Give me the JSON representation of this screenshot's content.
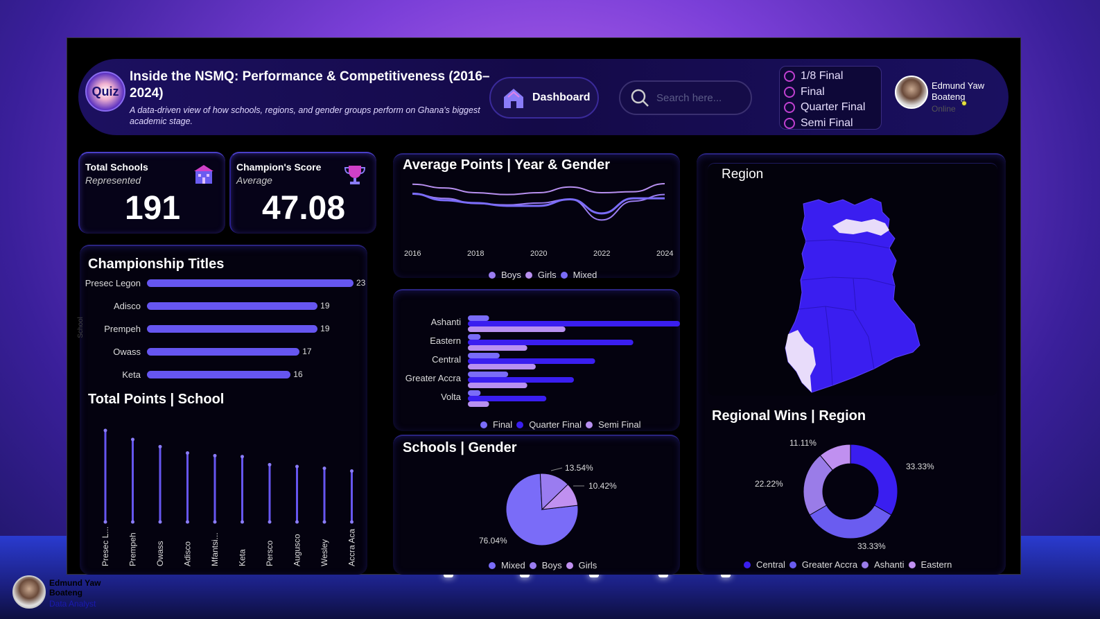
{
  "header": {
    "title": "Inside the NSMQ: Performance & Competitiveness (2016–2024)",
    "subtitle": "A data-driven view of how schools, regions, and gender groups perform on Ghana's biggest academic stage.",
    "logo_text": "Quiz",
    "dashboard_label": "Dashboard",
    "search_placeholder": "Search here...",
    "stage_filters": [
      "1/8 Final",
      "Final",
      "Quarter Final",
      "Semi Final"
    ],
    "user_name_line1": "Edmund Yaw",
    "user_name_line2": "Boateng",
    "user_status": "Online"
  },
  "kpis": {
    "schools": {
      "title": "Total Schools",
      "subtitle": "Represented",
      "value": "191"
    },
    "champion": {
      "title": "Champion's Score",
      "subtitle": "Average",
      "value": "47.08"
    }
  },
  "colors": {
    "accent": "#6656f0",
    "boys": "#9a7cf0",
    "girls": "#b890f0",
    "mixed": "#7a6cf8",
    "central": "#3a1ef0",
    "greater_accra": "#6a5cf0",
    "ashanti": "#9a7ce8",
    "eastern": "#c090f0"
  },
  "championship": {
    "title": "Championship Titles",
    "axis_label": "School",
    "schools": [
      "Presec Legon",
      "Adisco",
      "Prempeh",
      "Owass",
      "Keta"
    ],
    "values": [
      23,
      19,
      19,
      17,
      16
    ]
  },
  "total_points": {
    "title": "Total Points | School",
    "schools": [
      "Presec L...",
      "Prempeh",
      "Owass",
      "Adisco",
      "Mfantsi...",
      "Keta",
      "Persco",
      "Augusco",
      "Wesley",
      "Accra Aca"
    ],
    "relative": [
      1.0,
      0.9,
      0.82,
      0.75,
      0.72,
      0.71,
      0.62,
      0.6,
      0.58,
      0.55
    ]
  },
  "chart_data": [
    {
      "type": "line",
      "title": "Average Points | Year & Gender",
      "x": [
        2016,
        2017,
        2018,
        2019,
        2020,
        2021,
        2022,
        2023,
        2024
      ],
      "x_ticks": [
        "2016",
        "2018",
        "2020",
        "2022",
        "2024"
      ],
      "series": [
        {
          "name": "Boys",
          "values": [
            0.75,
            0.66,
            0.55,
            0.52,
            0.56,
            0.64,
            0.2,
            0.6,
            0.74
          ]
        },
        {
          "name": "Girls",
          "values": [
            0.96,
            0.88,
            0.78,
            0.74,
            0.78,
            0.9,
            0.78,
            0.8,
            0.97
          ]
        },
        {
          "name": "Mixed",
          "values": [
            0.76,
            0.62,
            0.56,
            0.5,
            0.5,
            0.64,
            0.34,
            0.66,
            0.66
          ]
        }
      ]
    },
    {
      "type": "bar",
      "orientation": "horizontal",
      "categories": [
        "Ashanti",
        "Eastern",
        "Central",
        "Greater Accra",
        "Volta"
      ],
      "series": [
        {
          "name": "Final",
          "values": [
            0.1,
            0.06,
            0.15,
            0.19,
            0.06
          ]
        },
        {
          "name": "Quarter Final",
          "values": [
            1.0,
            0.78,
            0.6,
            0.5,
            0.37
          ]
        },
        {
          "name": "Semi Final",
          "values": [
            0.46,
            0.28,
            0.32,
            0.28,
            0.1
          ]
        }
      ]
    },
    {
      "type": "pie",
      "title": "Schools | Gender",
      "labels": [
        "Mixed",
        "Boys",
        "Girls"
      ],
      "values": [
        76.04,
        13.54,
        10.42
      ],
      "value_labels": [
        "76.04%",
        "13.54%",
        "10.42%"
      ]
    },
    {
      "type": "pie",
      "variant": "donut",
      "title": "Regional Wins | Region",
      "labels": [
        "Central",
        "Greater Accra",
        "Ashanti",
        "Eastern"
      ],
      "values": [
        33.33,
        33.33,
        22.22,
        11.11
      ],
      "value_labels": [
        "33.33%",
        "33.33%",
        "22.22%",
        "11.11%"
      ]
    }
  ],
  "map": {
    "title": "Region"
  },
  "footer": {
    "name_line1": "Edmund Yaw",
    "name_line2": "Boateng",
    "role": "Data Analyst"
  }
}
